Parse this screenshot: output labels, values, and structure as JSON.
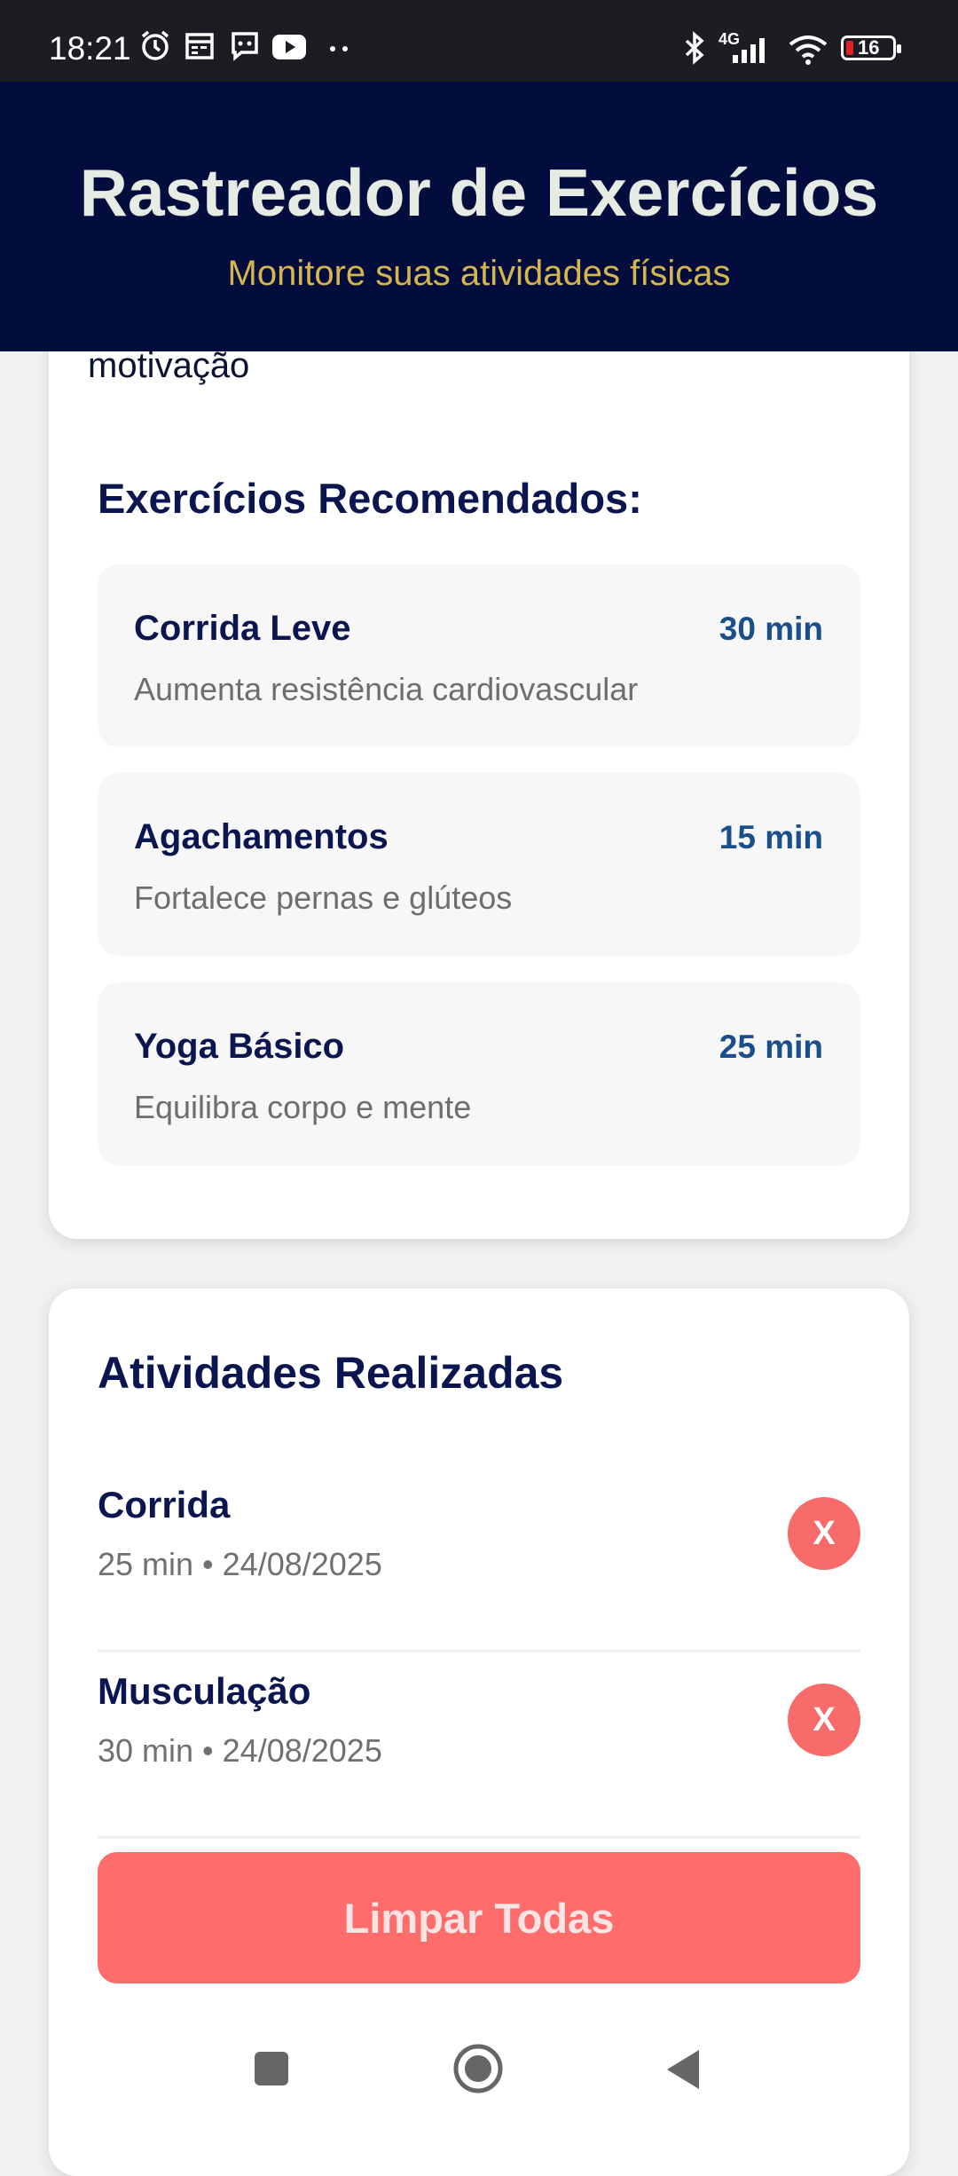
{
  "status_bar": {
    "time": "18:21",
    "battery": "16",
    "network": "4G",
    "icons": [
      "alarm-icon",
      "calendar-icon",
      "message-icon",
      "youtube-icon",
      "more-dots-icon",
      "bluetooth-icon",
      "signal-icon",
      "wifi-icon",
      "battery-icon"
    ]
  },
  "header": {
    "title": "Rastreador de Exercícios",
    "subtitle": "Monitore suas atividades físicas"
  },
  "top_card": {
    "partial_text": "motivação",
    "section_title": "Exercícios Recomendados:",
    "recommendations": [
      {
        "name": "Corrida Leve",
        "duration": "30 min",
        "description": "Aumenta resistência cardiovascular"
      },
      {
        "name": "Agachamentos",
        "duration": "15 min",
        "description": "Fortalece pernas e glúteos"
      },
      {
        "name": "Yoga Básico",
        "duration": "25 min",
        "description": "Equilibra corpo e mente"
      }
    ]
  },
  "activities": {
    "title": "Atividades Realizadas",
    "items": [
      {
        "name": "Corrida",
        "meta": "25 min • 24/08/2025",
        "delete_label": "X"
      },
      {
        "name": "Musculação",
        "meta": "30 min • 24/08/2025",
        "delete_label": "X"
      }
    ],
    "clear_label": "Limpar Todas"
  },
  "colors": {
    "header_bg": "#020d3d",
    "subtitle": "#d4b54f",
    "accent": "#1a4f8b",
    "danger": "#fe6c6c"
  }
}
